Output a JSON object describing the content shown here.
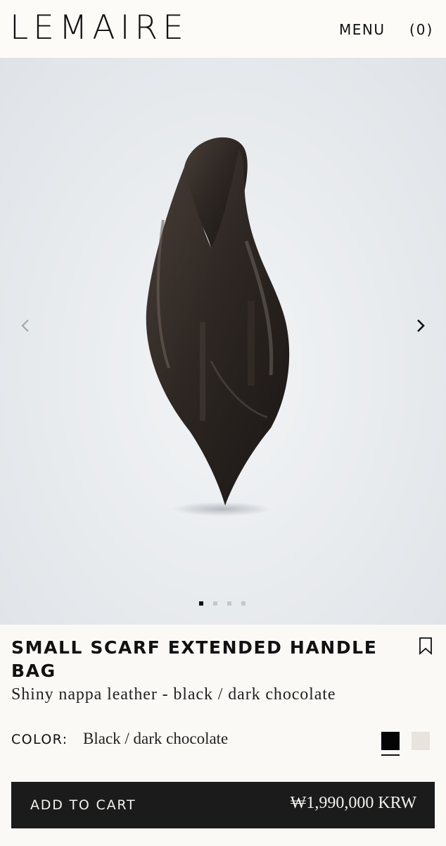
{
  "header": {
    "logo": "LEMAIRE",
    "menu_label": "MENU",
    "cart_label": "(0)"
  },
  "gallery": {
    "image_alt": "Small Scarf Extended Handle Bag",
    "slide_count": 4,
    "active_slide": 1
  },
  "product": {
    "title": "SMALL SCARF EXTENDED HANDLE BAG",
    "subtitle": "Shiny nappa leather - black / dark chocolate",
    "color_label": "COLOR:",
    "color_value": "Black / dark chocolate",
    "swatches": [
      {
        "name": "Black / dark chocolate",
        "hex": "#050505",
        "selected": true
      },
      {
        "name": "cream",
        "hex": "#e8e3dc",
        "selected": false
      }
    ]
  },
  "cart": {
    "add_label": "ADD TO CART",
    "price": "₩1,990,000 KRW"
  },
  "colors": {
    "page_bg": "#fbf9f6",
    "button_bg": "#1b1b1b",
    "text": "#111111"
  },
  "icons": {
    "prev": "chevron-left-icon",
    "next": "chevron-right-icon",
    "bookmark": "bookmark-icon"
  }
}
